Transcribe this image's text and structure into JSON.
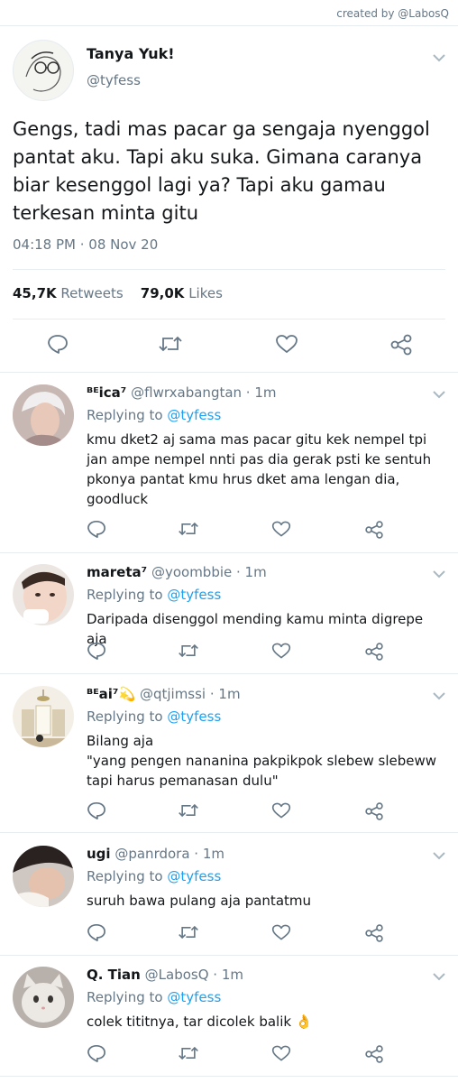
{
  "header": {
    "credit": "created by @LabosQ"
  },
  "main_tweet": {
    "name": "Tanya Yuk!",
    "handle": "@tyfess",
    "text": "Gengs, tadi mas pacar ga sengaja nyenggol pantat aku. Tapi aku suka. Gimana caranya biar kesenggol lagi ya? Tapi aku gamau terkesan minta gitu",
    "timestamp": "04:18 PM · 08 Nov 20",
    "retweets_count": "45,7K",
    "retweets_label": "Retweets",
    "likes_count": "79,0K",
    "likes_label": "Likes"
  },
  "replies": [
    {
      "name": "ᴮᴱica⁷",
      "meta": "@flwrxabangtan · 1m",
      "replying_prefix": "Replying to",
      "replying_handle": "@tyfess",
      "text": "kmu dket2 aj sama mas pacar gitu kek nempel tpi jan ampe nempel nnti pas dia gerak psti ke sentuh pkonya pantat kmu hrus dket ama lengan dia, goodluck"
    },
    {
      "name": "mareta⁷",
      "meta": "@yoombbie · 1m",
      "replying_prefix": "Replying to",
      "replying_handle": "@tyfess",
      "text": "Daripada disenggol mending kamu minta digrepe aja"
    },
    {
      "name": "ᴮᴱai⁷💫",
      "meta": "@qtjimssi · 1m",
      "replying_prefix": "Replying to",
      "replying_handle": "@tyfess",
      "text": "Bilang aja\n\"yang pengen nananina pakpikpok slebew slebeww tapi harus pemanasan dulu\""
    },
    {
      "name": "ugi",
      "meta": "@panrdora · 1m",
      "replying_prefix": "Replying to",
      "replying_handle": "@tyfess",
      "text": "suruh bawa pulang aja pantatmu"
    },
    {
      "name": "Q. Tian",
      "meta": "@LabosQ · 1m",
      "replying_prefix": "Replying to",
      "replying_handle": "@tyfess",
      "text": "colek tititnya, tar dicolek balik 👌"
    }
  ],
  "colors": {
    "link": "#1da1f2",
    "muted": "#657786",
    "text": "#14171a",
    "divider": "#e6ecf0"
  },
  "icons": [
    "reply-icon",
    "retweet-icon",
    "like-icon",
    "share-icon",
    "chevron-down-icon"
  ]
}
